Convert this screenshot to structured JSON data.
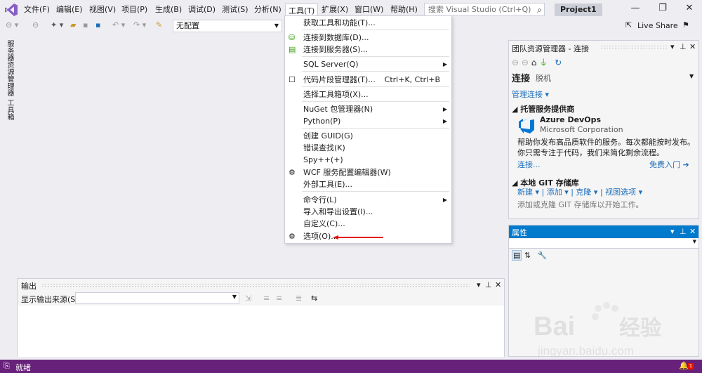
{
  "menubar": {
    "items": [
      "文件(F)",
      "编辑(E)",
      "视图(V)",
      "项目(P)",
      "生成(B)",
      "调试(D)",
      "测试(S)",
      "分析(N)",
      "工具(T)",
      "扩展(X)",
      "窗口(W)",
      "帮助(H)"
    ],
    "search_placeholder": "搜索 Visual Studio (Ctrl+Q)",
    "project_name": "Project1"
  },
  "toolbar": {
    "config_value": "无配置",
    "live_share": "Live Share"
  },
  "side_tabs": [
    "服务器资源管理器",
    "工具箱"
  ],
  "tools_menu": {
    "items": [
      {
        "label": "获取工具和功能(T)...",
        "shortcut": "",
        "submenu": false,
        "icon": ""
      },
      {
        "label": "连接到数据库(D)...",
        "shortcut": "",
        "submenu": false,
        "icon": "database-icon"
      },
      {
        "label": "连接到服务器(S)...",
        "shortcut": "",
        "submenu": false,
        "icon": "server-icon"
      },
      {
        "label": "SQL Server(Q)",
        "shortcut": "",
        "submenu": true,
        "icon": ""
      },
      {
        "label": "代码片段管理器(T)...",
        "shortcut": "Ctrl+K, Ctrl+B",
        "submenu": false,
        "icon": "checkbox-icon"
      },
      {
        "label": "选择工具箱项(X)...",
        "shortcut": "",
        "submenu": false,
        "icon": ""
      },
      {
        "label": "NuGet 包管理器(N)",
        "shortcut": "",
        "submenu": true,
        "icon": ""
      },
      {
        "label": "Python(P)",
        "shortcut": "",
        "submenu": true,
        "icon": ""
      },
      {
        "label": "创建 GUID(G)",
        "shortcut": "",
        "submenu": false,
        "icon": ""
      },
      {
        "label": "错误查找(K)",
        "shortcut": "",
        "submenu": false,
        "icon": ""
      },
      {
        "label": "Spy++(+)",
        "shortcut": "",
        "submenu": false,
        "icon": ""
      },
      {
        "label": "WCF 服务配置编辑器(W)",
        "shortcut": "",
        "submenu": false,
        "icon": "gears-icon"
      },
      {
        "label": "外部工具(E)...",
        "shortcut": "",
        "submenu": false,
        "icon": ""
      },
      {
        "label": "命令行(L)",
        "shortcut": "",
        "submenu": true,
        "icon": ""
      },
      {
        "label": "导入和导出设置(I)...",
        "shortcut": "",
        "submenu": false,
        "icon": ""
      },
      {
        "label": "自定义(C)...",
        "shortcut": "",
        "submenu": false,
        "icon": ""
      },
      {
        "label": "选项(O)...",
        "shortcut": "",
        "submenu": false,
        "icon": "gear-icon"
      }
    ]
  },
  "output": {
    "title": "输出",
    "source_label": "显示输出来源(S):"
  },
  "team_explorer": {
    "title": "团队资源管理器 - 连接",
    "connect": "连接",
    "disconnect": "脱机",
    "manage": "管理连接 ▾",
    "hosted_section": "托管服务提供商",
    "azure_name": "Azure DevOps",
    "azure_corp": "Microsoft Corporation",
    "azure_desc": "帮助你发布高品质软件的服务。每次都能按时发布。你只需专注于代码，我们来简化剩余流程。",
    "azure_connect": "连接...",
    "azure_start": "免费入门",
    "git_section": "本地 GIT 存储库",
    "git_actions": "新建 ▾ | 添加 ▾ | 克隆 ▾ | 视图选项 ▾",
    "git_hint": "添加或克隆 GIT 存储库以开始工作。"
  },
  "properties": {
    "title": "属性"
  },
  "status": {
    "text": "就绪",
    "notif_count": "1"
  },
  "colors": {
    "accent": "#007acc",
    "statusbar": "#68217a",
    "vs_logo": "#865fc5",
    "red_arrow": "#e51400"
  }
}
